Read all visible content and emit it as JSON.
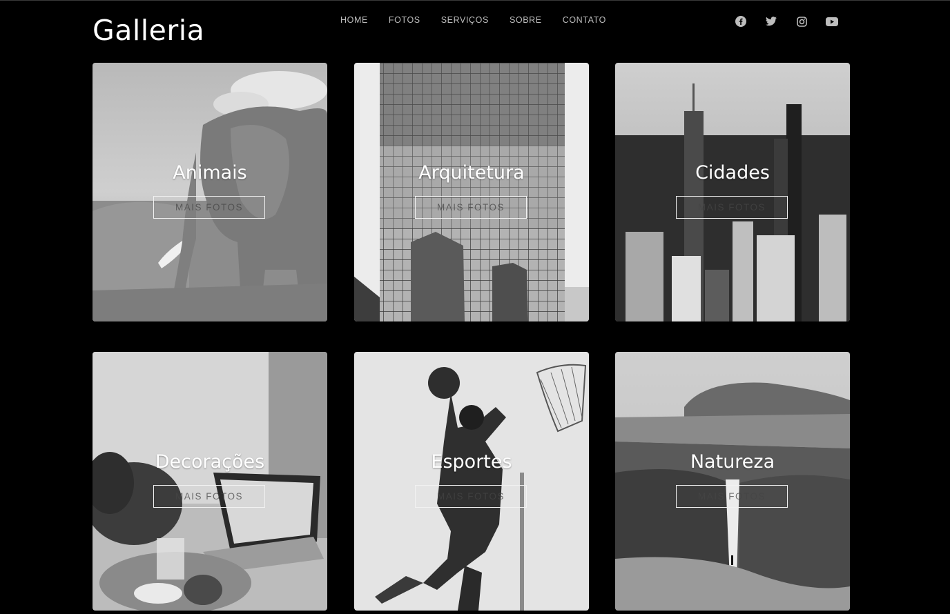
{
  "header": {
    "logo": "Galleria",
    "nav": [
      "HOME",
      "FOTOS",
      "SERVIÇOS",
      "SOBRE",
      "CONTATO"
    ],
    "social": [
      "facebook-icon",
      "twitter-icon",
      "instagram-icon",
      "youtube-icon"
    ]
  },
  "gallery": {
    "cards": [
      {
        "title": "Animais",
        "button": "MAIS FOTOS",
        "image": "elephant-photo"
      },
      {
        "title": "Arquitetura",
        "button": "MAIS FOTOS",
        "image": "glass-building-photo"
      },
      {
        "title": "Cidades",
        "button": "MAIS FOTOS",
        "image": "city-skyline-photo"
      },
      {
        "title": "Decorações",
        "button": "MAIS FOTOS",
        "image": "cafe-laptop-photo"
      },
      {
        "title": "Esportes",
        "button": "MAIS FOTOS",
        "image": "basketball-dunk-photo"
      },
      {
        "title": "Natureza",
        "button": "MAIS FOTOS",
        "image": "waterfall-landscape-photo"
      }
    ]
  },
  "colors": {
    "background": "#000000",
    "text": "#ffffff",
    "nav": "#bdbdbd"
  }
}
